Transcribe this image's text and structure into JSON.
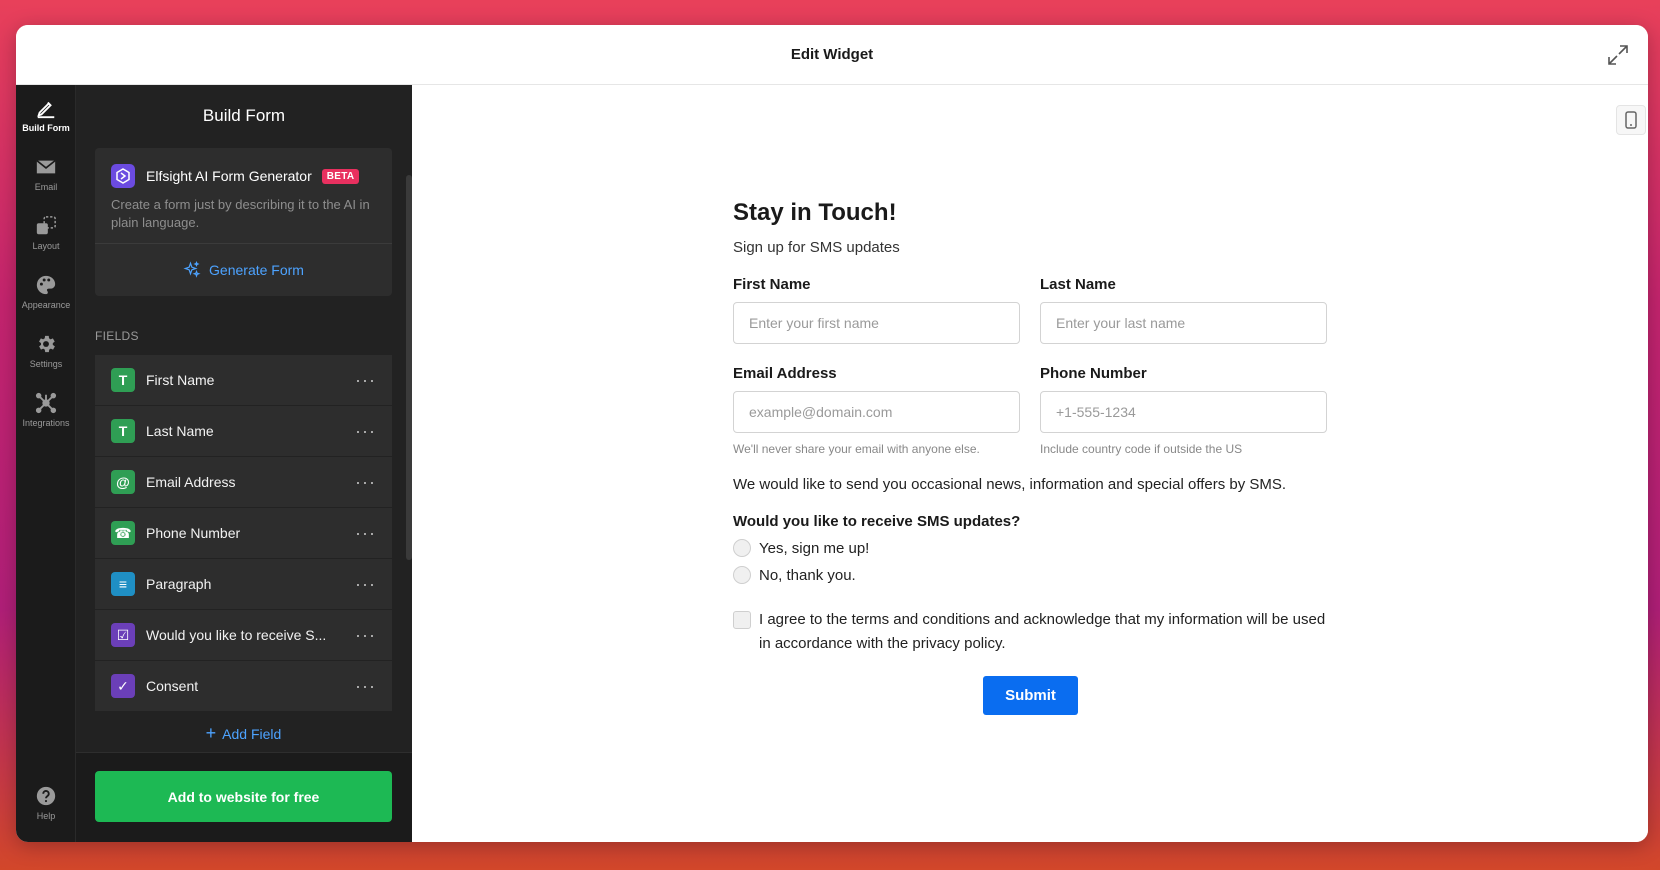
{
  "window": {
    "title": "Edit Widget"
  },
  "rail": {
    "items": [
      {
        "label": "Build Form",
        "icon": "pen-icon"
      },
      {
        "label": "Email",
        "icon": "envelope-icon"
      },
      {
        "label": "Layout",
        "icon": "layout-icon"
      },
      {
        "label": "Appearance",
        "icon": "palette-icon"
      },
      {
        "label": "Settings",
        "icon": "gear-icon"
      },
      {
        "label": "Integrations",
        "icon": "integrations-icon"
      }
    ],
    "help": {
      "label": "Help",
      "icon": "help-icon"
    }
  },
  "panel": {
    "title": "Build Form",
    "ai": {
      "title": "Elfsight AI Form Generator",
      "badge": "BETA",
      "description": "Create a form just by describing it to the AI in plain language.",
      "button": "Generate Form"
    },
    "fields_label": "FIELDS",
    "fields": [
      {
        "name": "First Name",
        "icon": "text-icon",
        "glyph": "T",
        "color": "#2f9e54"
      },
      {
        "name": "Last Name",
        "icon": "text-icon",
        "glyph": "T",
        "color": "#2f9e54"
      },
      {
        "name": "Email Address",
        "icon": "at-icon",
        "glyph": "@",
        "color": "#2f9e54"
      },
      {
        "name": "Phone Number",
        "icon": "phone-icon",
        "glyph": "☎",
        "color": "#2f9e54"
      },
      {
        "name": "Paragraph",
        "icon": "paragraph-icon",
        "glyph": "≡",
        "color": "#1f8fc4"
      },
      {
        "name": "Would you like to receive S...",
        "icon": "radio-select-icon",
        "glyph": "☑",
        "color": "#6b3fb8"
      },
      {
        "name": "Consent",
        "icon": "checkbox-icon",
        "glyph": "✓",
        "color": "#6b3fb8"
      }
    ],
    "add_field": "Add Field",
    "cta": "Add to website for free"
  },
  "form": {
    "title": "Stay in Touch!",
    "subtitle": "Sign up for SMS updates",
    "first_name": {
      "label": "First Name",
      "placeholder": "Enter your first name"
    },
    "last_name": {
      "label": "Last Name",
      "placeholder": "Enter your last name"
    },
    "email": {
      "label": "Email Address",
      "placeholder": "example@domain.com",
      "hint": "We'll never share your email with anyone else."
    },
    "phone": {
      "label": "Phone Number",
      "placeholder": "+1-555-1234",
      "hint": "Include country code if outside the US"
    },
    "paragraph": "We would like to send you occasional news, information and special offers by SMS.",
    "question": "Would you like to receive SMS updates?",
    "options": [
      "Yes, sign me up!",
      "No, thank you."
    ],
    "consent": "I agree to the terms and conditions and acknowledge that my information will be used in accordance with the privacy policy.",
    "submit": "Submit"
  },
  "colors": {
    "accent": "#0a6df0",
    "cta": "#1db954",
    "beta": "#e8305f",
    "link": "#4da3ff"
  }
}
